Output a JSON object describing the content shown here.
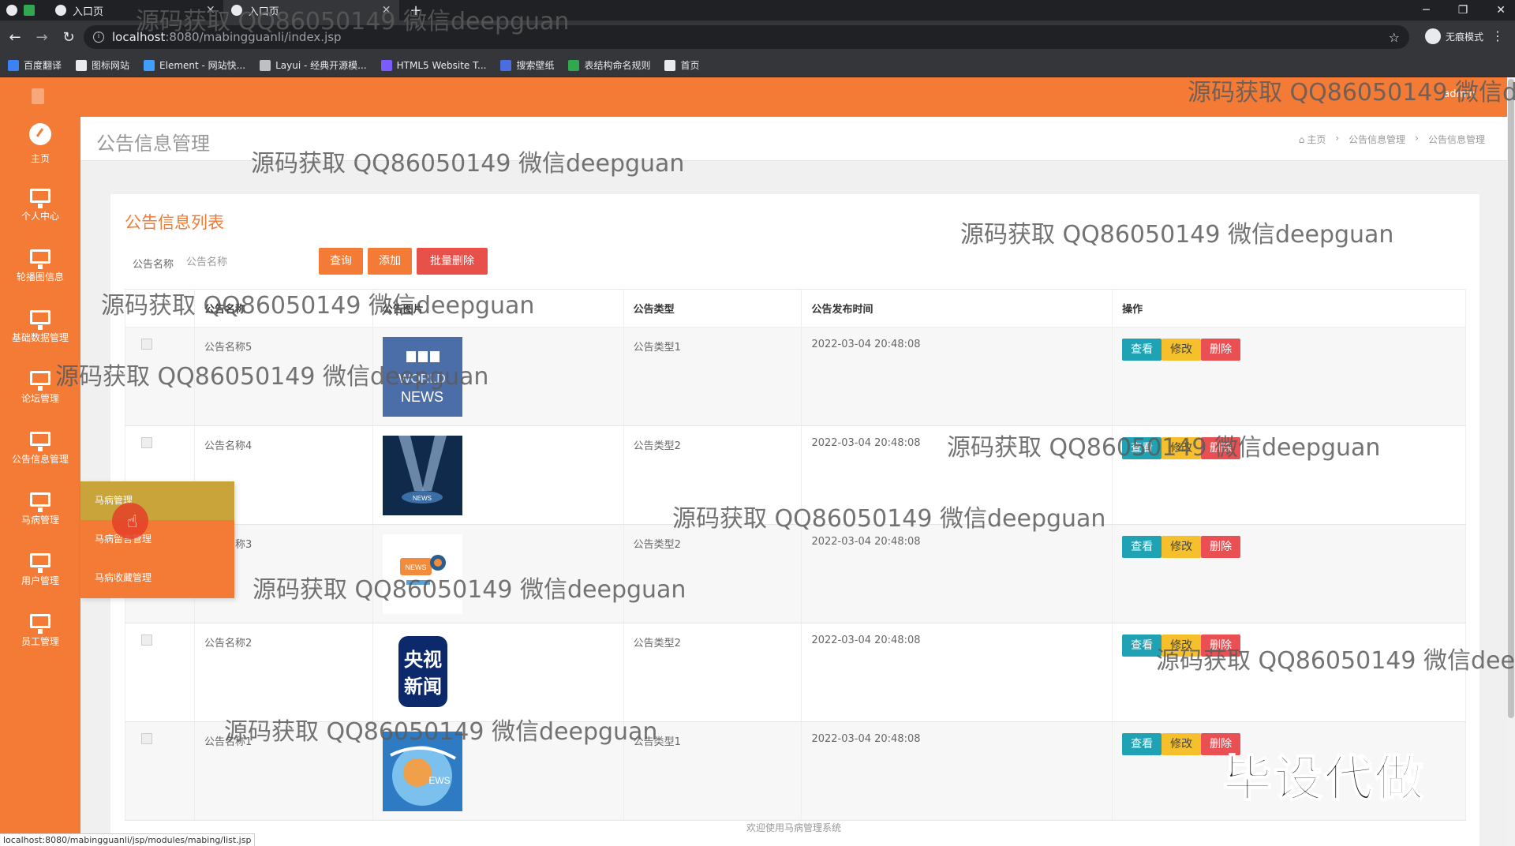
{
  "browser": {
    "tabs": [
      {
        "title": "入口页"
      },
      {
        "title": "入口页"
      }
    ],
    "new_tab_glyph": "+",
    "url_host": "localhost",
    "url_path": ":8080/mabingguanli/index.jsp",
    "profile_label": "无痕模式",
    "bookmarks": [
      {
        "label": "百度翻译",
        "color": "#3b82f6"
      },
      {
        "label": "图标网站",
        "color": "#e8eaed"
      },
      {
        "label": "Element - 网站快...",
        "color": "#409eff"
      },
      {
        "label": "Layui - 经典开源模...",
        "color": "#bdc1c6"
      },
      {
        "label": "HTML5 Website T...",
        "color": "#7c5cff"
      },
      {
        "label": "搜索壁纸",
        "color": "#4a6ee0"
      },
      {
        "label": "表结构命名规则",
        "color": "#2fa84f"
      },
      {
        "label": "首页",
        "color": "#e8eaed"
      }
    ]
  },
  "header": {
    "user_label": "admin"
  },
  "sidebar": {
    "items": [
      {
        "label": "主页",
        "icon": "dashboard-icon"
      },
      {
        "label": "个人中心",
        "icon": "monitor-icon"
      },
      {
        "label": "轮播图信息",
        "icon": "monitor-icon"
      },
      {
        "label": "基础数据管理",
        "icon": "monitor-icon"
      },
      {
        "label": "论坛管理",
        "icon": "monitor-icon"
      },
      {
        "label": "公告信息管理",
        "icon": "monitor-icon"
      },
      {
        "label": "马病管理",
        "icon": "monitor-icon"
      },
      {
        "label": "用户管理",
        "icon": "monitor-icon"
      },
      {
        "label": "员工管理",
        "icon": "monitor-icon"
      }
    ],
    "submenu": [
      "马病管理",
      "马病留言管理",
      "马病收藏管理"
    ]
  },
  "page": {
    "title": "公告信息管理",
    "breadcrumb": [
      "主页",
      "›",
      "公告信息管理",
      "›",
      "公告信息管理"
    ]
  },
  "panel": {
    "title": "公告信息列表",
    "search_label": "公告名称",
    "search_placeholder": "公告名称",
    "buttons": {
      "query": "查询",
      "add": "添加",
      "batch_delete": "批量删除"
    }
  },
  "table": {
    "headers": [
      "",
      "公告名称",
      "公告图片",
      "公告类型",
      "公告发布时间",
      "操作"
    ],
    "rows": [
      {
        "name": "公告名称5",
        "type": "公告类型1",
        "time": "2022-03-04 20:48:08",
        "image": "bbc-world-news"
      },
      {
        "name": "公告名称4",
        "type": "公告类型2",
        "time": "2022-03-04 20:48:08",
        "image": "spotlight-news"
      },
      {
        "name": "公告名称3",
        "type": "公告类型2",
        "time": "2022-03-04 20:48:08",
        "image": "news-megaphone"
      },
      {
        "name": "公告名称2",
        "type": "公告类型2",
        "time": "2022-03-04 20:48:08",
        "image": "cctv-news"
      },
      {
        "name": "公告名称1",
        "type": "公告类型1",
        "time": "2022-03-04 20:48:08",
        "image": "globe-news"
      }
    ],
    "ops": {
      "view": "查看",
      "edit": "修改",
      "delete": "删除"
    }
  },
  "footer": "欢迎使用马病管理系统",
  "status_url": "localhost:8080/mabingguanli/jsp/modules/mabing/list.jsp",
  "overlay": {
    "watermark": "源码获取 QQ86050149 微信deepguan",
    "promo": "毕设代做"
  },
  "colors": {
    "primary": "#f47b36",
    "danger": "#ea4f53",
    "info": "#1fa2b4",
    "warning": "#f5c02b"
  }
}
